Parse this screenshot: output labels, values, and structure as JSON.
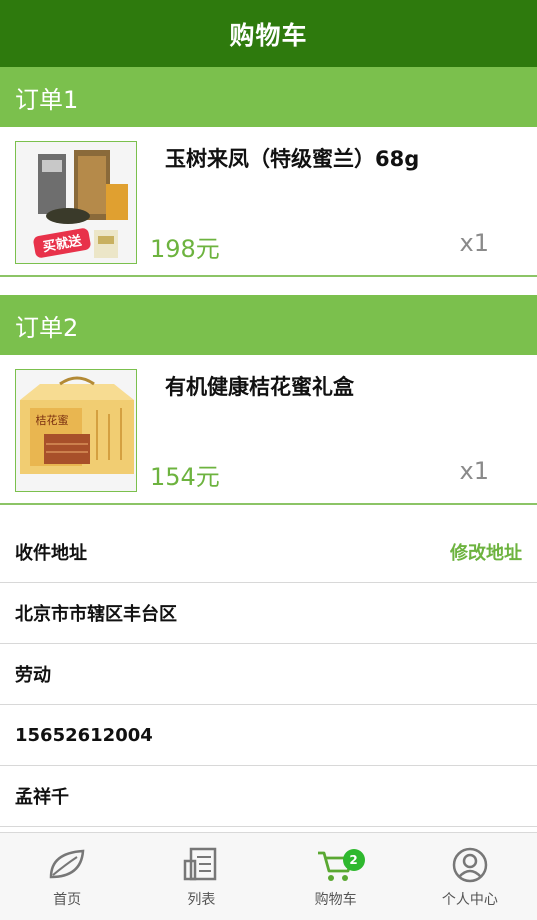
{
  "header": {
    "title": "购物车"
  },
  "orders": [
    {
      "label": "订单1",
      "product_name": "玉树来凤（特级蜜兰）68g",
      "price": "198元",
      "quantity": "x1",
      "image_badge_text": "买就送"
    },
    {
      "label": "订单2",
      "product_name": "有机健康桔花蜜礼盒",
      "price": "154元",
      "quantity": "x1",
      "image_box_text": "桔花蜜"
    }
  ],
  "address": {
    "section_label": "收件地址",
    "edit_label": "修改地址",
    "region": "北京市市辖区丰台区",
    "street": "劳动",
    "phone": "15652612004",
    "recipient": "孟祥千"
  },
  "tabbar": {
    "items": [
      {
        "label": "首页",
        "icon": "leaf-icon"
      },
      {
        "label": "列表",
        "icon": "list-icon"
      },
      {
        "label": "购物车",
        "icon": "cart-icon",
        "badge": "2"
      },
      {
        "label": "个人中心",
        "icon": "user-icon"
      }
    ]
  },
  "colors": {
    "header_bg": "#2e7a0d",
    "order_bar_bg": "#7bc04d",
    "accent_green": "#6db33f",
    "badge_bg": "#2eb82e"
  }
}
